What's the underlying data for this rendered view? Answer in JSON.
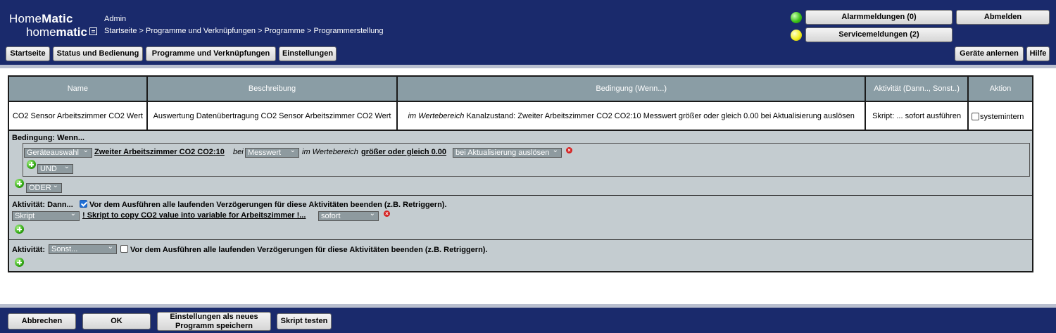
{
  "header": {
    "logo_line1_a": "Home",
    "logo_line1_b": "Matic",
    "logo_line2_a": "home",
    "logo_line2_b": "matic",
    "user": "Admin",
    "breadcrumb": "Startseite > Programme und Verknüpfungen > Programme > Programmerstellung",
    "alarm_button": "Alarmmeldungen (0)",
    "service_button": "Servicemeldungen (2)",
    "logout_button": "Abmelden",
    "alarm_led_color": "#3ec21a",
    "service_led_color": "#f2ee22"
  },
  "nav": {
    "start": "Startseite",
    "status": "Status und Bedienung",
    "programs": "Programme und Verknüpfungen",
    "settings": "Einstellungen",
    "teach": "Geräte anlernen",
    "help": "Hilfe"
  },
  "table": {
    "headers": [
      "Name",
      "Beschreibung",
      "Bedingung (Wenn...)",
      "Aktivität (Dann.., Sonst..)",
      "Aktion"
    ],
    "row": {
      "name": "CO2 Sensor Arbeitszimmer CO2 Wert",
      "description": "Auswertung Datenübertragung CO2 Sensor Arbeitszimmer CO2 Wert",
      "condition_italic": "im Wertebereich",
      "condition_rest": " Kanalzustand: Zweiter Arbeitszimmer CO2 CO2:10 Messwert größer oder gleich 0.00 bei Aktualisierung auslösen",
      "activity": "Skript: ... sofort ausführen",
      "action_checkbox_label": "systemintern"
    }
  },
  "editor": {
    "condition": {
      "title": "Bedingung: Wenn...",
      "select_type": "Geräteauswahl",
      "device_link": "Zweiter Arbeitszimmer CO2 CO2:10",
      "word_bei": "bei",
      "select_value": "Messwert",
      "word_range": "im Wertebereich",
      "operator_link": "größer oder gleich 0.00",
      "select_trigger": "bei Aktualisierung auslösen",
      "select_and": "UND",
      "select_or": "ODER"
    },
    "then": {
      "title": "Aktivität: Dann...",
      "checkbox_label": "Vor dem Ausführen alle laufenden Verzögerungen für diese Aktivitäten beenden (z.B. Retriggern).",
      "select_type": "Skript",
      "script_link": "! Skript to copy CO2 value into variable for Arbeitszimmer !...",
      "select_timing": "sofort"
    },
    "else": {
      "title": "Aktivität:",
      "select_else": "Sonst...",
      "checkbox_label": "Vor dem Ausführen alle laufenden Verzögerungen für diese Aktivitäten beenden (z.B. Retriggern)."
    }
  },
  "footer": {
    "cancel": "Abbrechen",
    "ok": "OK",
    "save_new_line1": "Einstellungen als neues",
    "save_new_line2": "Programm speichern",
    "test_script": "Skript testen"
  }
}
